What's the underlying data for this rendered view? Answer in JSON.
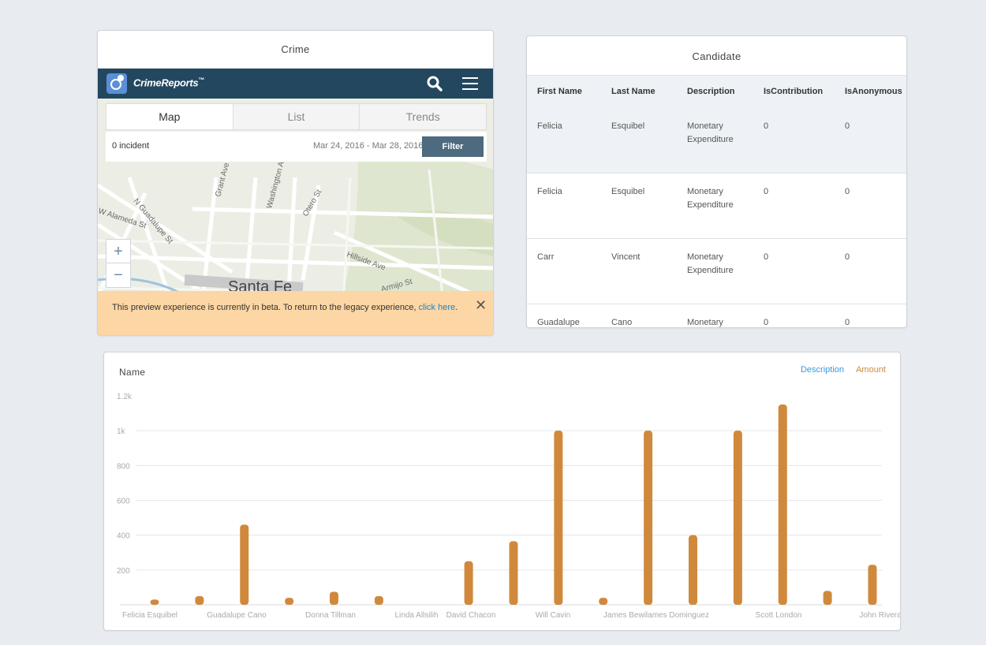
{
  "crime": {
    "title": "Crime",
    "brand": "CrimeReports",
    "brand_tm": "™",
    "tabs": [
      "Map",
      "List",
      "Trends"
    ],
    "incident_count": "0 incident",
    "date_range": "Mar 24, 2016 - Mar 28, 2016",
    "filter_label": "Filter",
    "map_city": "Santa Fe",
    "map_streets": [
      "N Guadalupe St",
      "Grant Ave",
      "Washington Ave",
      "Otero St",
      "W Alameda St",
      "Hillside Ave",
      "Armijo St"
    ],
    "zoom_in": "+",
    "zoom_out": "−",
    "beta_text": "This preview experience is currently in beta. To return to the legacy experience, ",
    "beta_link": "click here",
    "beta_link_end": ".",
    "close_glyph": "✕"
  },
  "candidate": {
    "title": "Candidate",
    "columns": [
      "First Name",
      "Last Name",
      "Description",
      "IsContribution",
      "IsAnonymous"
    ],
    "rows": [
      [
        "Felicia",
        "Esquibel",
        "Monetary Expenditure",
        "0",
        "0"
      ],
      [
        "Felicia",
        "Esquibel",
        "Monetary Expenditure",
        "0",
        "0"
      ],
      [
        "Carr",
        "Vincent",
        "Monetary Expenditure",
        "0",
        "0"
      ],
      [
        "Guadalupe",
        "Cano",
        "Monetary",
        "0",
        "0"
      ]
    ]
  },
  "chart": {
    "title": "Name",
    "legend": [
      {
        "label": "Description",
        "color": "#3a9ad9"
      },
      {
        "label": "Amount",
        "color": "#d0893c"
      }
    ]
  },
  "chart_data": {
    "type": "bar",
    "title": "Name",
    "ylim": [
      0,
      1200
    ],
    "yticks": [
      "200",
      "400",
      "600",
      "800",
      "1k",
      "1.2k"
    ],
    "x_labels": [
      "Felicia Esquibel",
      "Guadalupe Cano",
      "Donna Tillman",
      "Linda Allsilih",
      "David Chacon",
      "Will Cavin",
      "James Bewilames Dominguez",
      "Scott London",
      "John Rivera"
    ],
    "series": [
      {
        "name": "Amount",
        "color": "#d0893c",
        "values": [
          30,
          50,
          460,
          40,
          75,
          50,
          0,
          250,
          365,
          1000,
          40,
          1000,
          400,
          1000,
          1150,
          80,
          230
        ]
      }
    ],
    "grid": true,
    "legend_position": "top-right"
  }
}
